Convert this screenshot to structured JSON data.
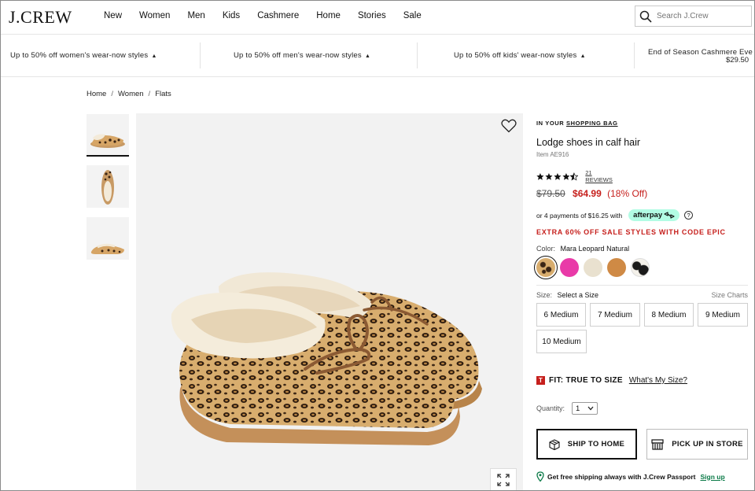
{
  "brand": {
    "logo": "J.CREW"
  },
  "nav": {
    "items": [
      "New",
      "Women",
      "Men",
      "Kids",
      "Cashmere",
      "Home",
      "Stories",
      "Sale"
    ]
  },
  "search": {
    "placeholder": "Search J.Crew"
  },
  "promo": {
    "items": [
      "Up to 50% off women's wear-now styles",
      "Up to 50% off men's wear-now styles",
      "Up to 50% off kids' wear-now styles"
    ],
    "last": "End of Season Cashmere Eve",
    "last_price": "$29.50"
  },
  "breadcrumb": [
    "Home",
    "Women",
    "Flats"
  ],
  "product": {
    "in_your": "IN YOUR",
    "shopping_bag": "SHOPPING BAG",
    "title": "Lodge shoes in calf hair",
    "item_no": "Item AE916",
    "rating": 4.5,
    "reviews": "21 REVIEWS",
    "was_price": "$79.50",
    "now_price": "$64.99",
    "discount": "(18% Off)",
    "installments": "or 4 payments of $16.25 with",
    "afterpay": "afterpay",
    "extra_offer": "EXTRA 60% OFF SALE STYLES WITH CODE EPIC",
    "color_label": "Color:",
    "color_value": "Mara Leopard Natural",
    "size_label": "Size:",
    "size_value": "Select a Size",
    "size_charts": "Size Charts",
    "sizes": [
      "6 Medium",
      "7 Medium",
      "8 Medium",
      "9 Medium",
      "10 Medium"
    ],
    "fit_badge": "T",
    "fit": "FIT: TRUE TO SIZE",
    "whats_my_size": "What's My Size?",
    "quantity_label": "Quantity:",
    "quantity": "1",
    "ship_to_home": "SHIP TO HOME",
    "pick_up": "PICK UP IN STORE",
    "passport_text": "Get free shipping always with J.Crew Passport",
    "sign_up": "Sign up"
  },
  "colors": {
    "sale_red": "#c6201d",
    "afterpay_mint": "#b2fce4",
    "passport_green": "#0a7a47",
    "swatch_pink": "#e93aa8",
    "swatch_cream": "#e9e1cf",
    "swatch_tan": "#cf8a45"
  }
}
